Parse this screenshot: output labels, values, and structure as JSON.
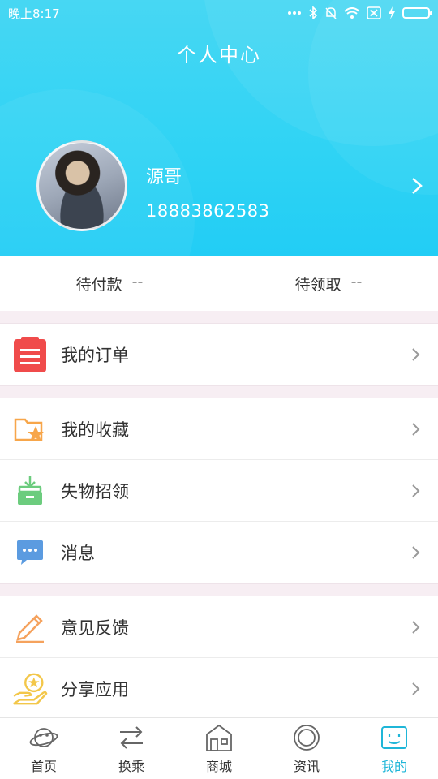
{
  "status_bar": {
    "time": "晚上8:17"
  },
  "header": {
    "title": "个人中心",
    "user_name": "源哥",
    "phone": "18883862583"
  },
  "counts": [
    {
      "label": "待付款",
      "value": "--"
    },
    {
      "label": "待领取",
      "value": "--"
    }
  ],
  "menu": {
    "orders": "我的订单",
    "favorites": "我的收藏",
    "lost_found": "失物招领",
    "messages": "消息",
    "feedback": "意见反馈",
    "share": "分享应用"
  },
  "tabs": [
    {
      "label": "首页",
      "icon": "planet-icon",
      "active": false
    },
    {
      "label": "换乘",
      "icon": "transfer-icon",
      "active": false
    },
    {
      "label": "商城",
      "icon": "shop-icon",
      "active": false
    },
    {
      "label": "资讯",
      "icon": "news-icon",
      "active": false
    },
    {
      "label": "我的",
      "icon": "profile-icon",
      "active": true
    }
  ],
  "colors": {
    "header_bg": "#2fd3f4",
    "active_tab": "#1fb6d8",
    "orders_icon": "#f04b4b",
    "favorites_icon": "#f7a64a",
    "lost_found_icon": "#6ccc7e",
    "messages_icon": "#5b9be0",
    "feedback_icon": "#f5a25d",
    "share_icon": "#f3c74a"
  }
}
